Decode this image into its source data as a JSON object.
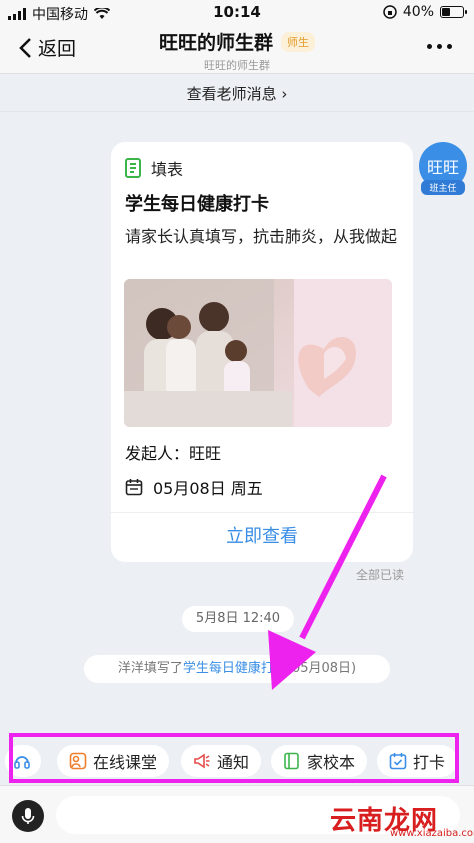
{
  "status_bar": {
    "carrier": "中国移动",
    "time": "10:14",
    "battery": "40%",
    "battery_level": 0.4
  },
  "header": {
    "back_label": "返回",
    "title": "旺旺的师生群",
    "badge": "师生",
    "subtitle": "旺旺的师生群"
  },
  "teacher_messages_link": "查看老师消息 ›",
  "avatar": {
    "name": "旺旺",
    "role": "班主任"
  },
  "card": {
    "type_label": "填表",
    "title": "学生每日健康打卡",
    "description": "请家长认真填写，抗击肺炎，从我做起",
    "initiator": "发起人：旺旺",
    "date": "05月08日 周五",
    "action": "立即查看"
  },
  "read_status": "全部已读",
  "timestamp": "5月8日 12:40",
  "notice": {
    "prefix": "洋洋填写了",
    "link": "学生每日健康打卡",
    "suffix": "(05月08日)"
  },
  "toolbar": {
    "items": [
      {
        "label": "在线课堂",
        "icon": "online-class-icon"
      },
      {
        "label": "通知",
        "icon": "megaphone-icon"
      },
      {
        "label": "家校本",
        "icon": "notebook-icon"
      },
      {
        "label": "打卡",
        "icon": "checkin-icon"
      }
    ]
  },
  "watermark": {
    "text": "云南龙网",
    "url": "www.xiazaiba.com"
  },
  "colors": {
    "accent": "#3a8ee6",
    "highlight": "#ee22ee",
    "badge": "#e39b2a"
  }
}
